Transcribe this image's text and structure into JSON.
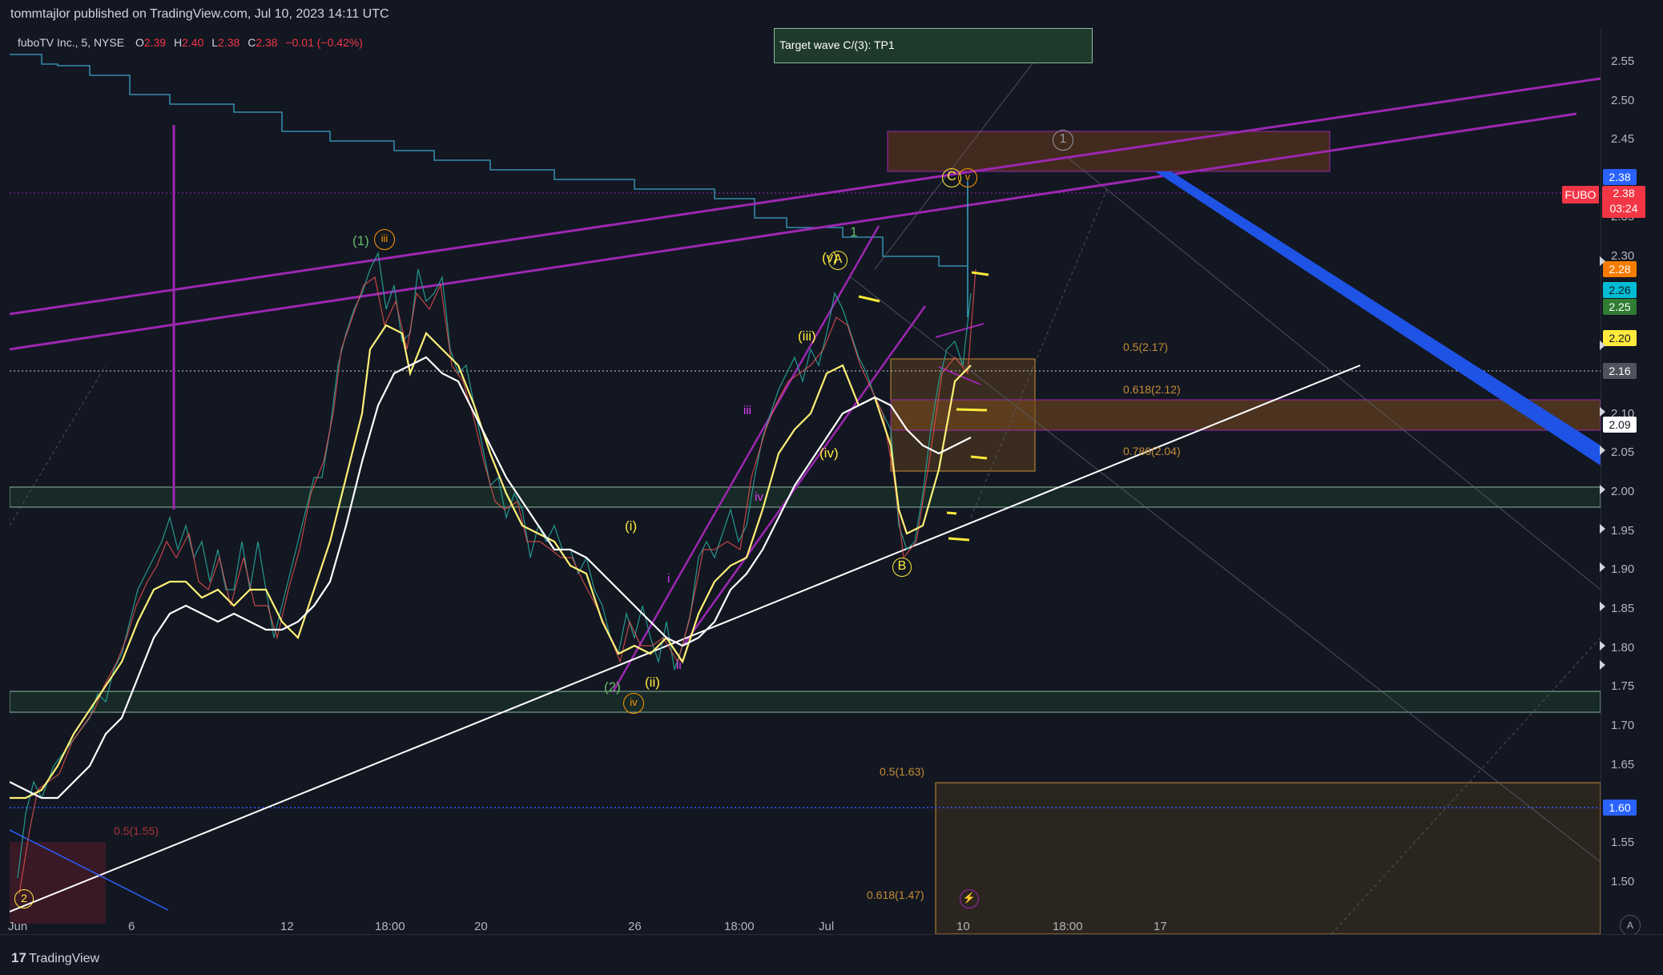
{
  "header": {
    "publish_line": "tommtajlor published on TradingView.com, Jul 10, 2023 14:11 UTC"
  },
  "symbol": {
    "name": "fuboTV Inc., 5, NYSE",
    "open_label": "O",
    "open": "2.39",
    "high_label": "H",
    "high": "2.40",
    "low_label": "L",
    "low": "2.38",
    "close_label": "C",
    "close": "2.38",
    "change": "−0.01 (−0.42%)"
  },
  "target_box": {
    "text": "Target wave C/(3): TP1"
  },
  "price_axis": {
    "ticks": [
      "2.55",
      "2.50",
      "2.45",
      "2.35",
      "2.30",
      "2.10",
      "2.05",
      "2.00",
      "1.95",
      "1.90",
      "1.85",
      "1.80",
      "1.75",
      "1.70",
      "1.65",
      "1.55",
      "1.50"
    ],
    "tags": [
      {
        "text": "2.38",
        "color": "#2962ff",
        "fg": "#ffffff"
      },
      {
        "text": "2.28",
        "color": "#f57c00",
        "fg": "#ffffff"
      },
      {
        "text": "2.26",
        "color": "#00bcd4",
        "fg": "#131722"
      },
      {
        "text": "2.25",
        "color": "#2e7d32",
        "fg": "#ffffff"
      },
      {
        "text": "2.20",
        "color": "#ffeb3b",
        "fg": "#131722"
      },
      {
        "text": "2.16",
        "color": "#50535e",
        "fg": "#ffffff"
      },
      {
        "text": "2.09",
        "color": "#ffffff",
        "fg": "#131722"
      },
      {
        "text": "1.60",
        "color": "#2962ff",
        "fg": "#ffffff"
      }
    ],
    "fubo_tag": "FUBO",
    "fubo_price": "2.38",
    "fubo_countdown": "03:24"
  },
  "time_axis": {
    "labels": [
      "Jun",
      "6",
      "12",
      "18:00",
      "20",
      "26",
      "18:00",
      "Jul",
      "10",
      "18:00",
      "17"
    ]
  },
  "fib_labels": {
    "upper_05": "0.5(2.17)",
    "upper_0618": "0.618(2.12)",
    "upper_0786": "0.786(2.04)",
    "lower_05": "0.5(1.63)",
    "lower_0618": "0.618(1.47)",
    "left_05": "0.5(1.55)"
  },
  "wave_labels": {
    "w1_green": "(1)",
    "w2_green": "(2)",
    "iii_orange": "iii",
    "iv_orange": "iv",
    "one_green": "1",
    "A_yellow": "A",
    "B_yellow": "B",
    "C_yellow": "C",
    "v_orange": "v",
    "i_paren": "(i)",
    "ii_paren": "(ii)",
    "iii_paren": "(iii)",
    "iv_paren": "(iv)",
    "v_paren": "(v)",
    "i_pink": "i",
    "ii_pink": "ii",
    "iii_pink": "iii",
    "iv_pink": "iv",
    "circle_one_gray": "1",
    "circle_two": "2"
  },
  "footer": {
    "brand": "TradingView",
    "auto_button": "A"
  },
  "colors": {
    "background": "#131722",
    "purple_lines": "#9c27b0",
    "blue_band": "#1e53e5",
    "yellow_ma": "#fff176",
    "white_ma": "#ffffff",
    "zone_green": "#1b3a2c",
    "zone_orange": "#6b4a1c"
  }
}
